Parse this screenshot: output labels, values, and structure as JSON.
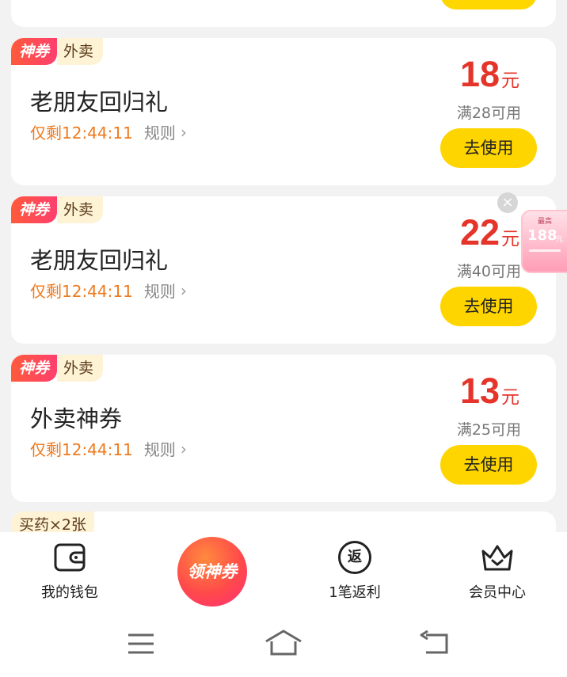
{
  "coupons": [
    {
      "tag": "神券",
      "category": "外卖",
      "title": "老朋友回归礼",
      "timer": "仅剩12:44:11",
      "rule": "规则",
      "amount": "18",
      "unit": "元",
      "condition": "满28可用",
      "button": "去使用"
    },
    {
      "tag": "神券",
      "category": "外卖",
      "title": "老朋友回归礼",
      "timer": "仅剩12:44:11",
      "rule": "规则",
      "amount": "22",
      "unit": "元",
      "condition": "满40可用",
      "button": "去使用"
    },
    {
      "tag": "神券",
      "category": "外卖",
      "title": "外卖神券",
      "timer": "仅剩12:44:11",
      "rule": "规则",
      "amount": "13",
      "unit": "元",
      "condition": "满25可用",
      "button": "去使用"
    }
  ],
  "partial_card": {
    "tag": "买药×2张"
  },
  "float_ad": {
    "small_text": "最高",
    "amount": "188",
    "unit": "元",
    "close": "×"
  },
  "tabbar": {
    "wallet": "我的钱包",
    "center": "领神券",
    "rebate": "1笔返利",
    "rebate_icon_text": "返",
    "member": "会员中心"
  },
  "icons": [
    "wallet-icon",
    "rebate-icon",
    "crown-icon",
    "menu-icon",
    "home-icon",
    "back-icon",
    "chevron-right-icon",
    "close-icon"
  ],
  "colors": {
    "accent_yellow": "#ffd500",
    "price_red": "#e5342a",
    "timer_orange": "#ee7a1e"
  }
}
